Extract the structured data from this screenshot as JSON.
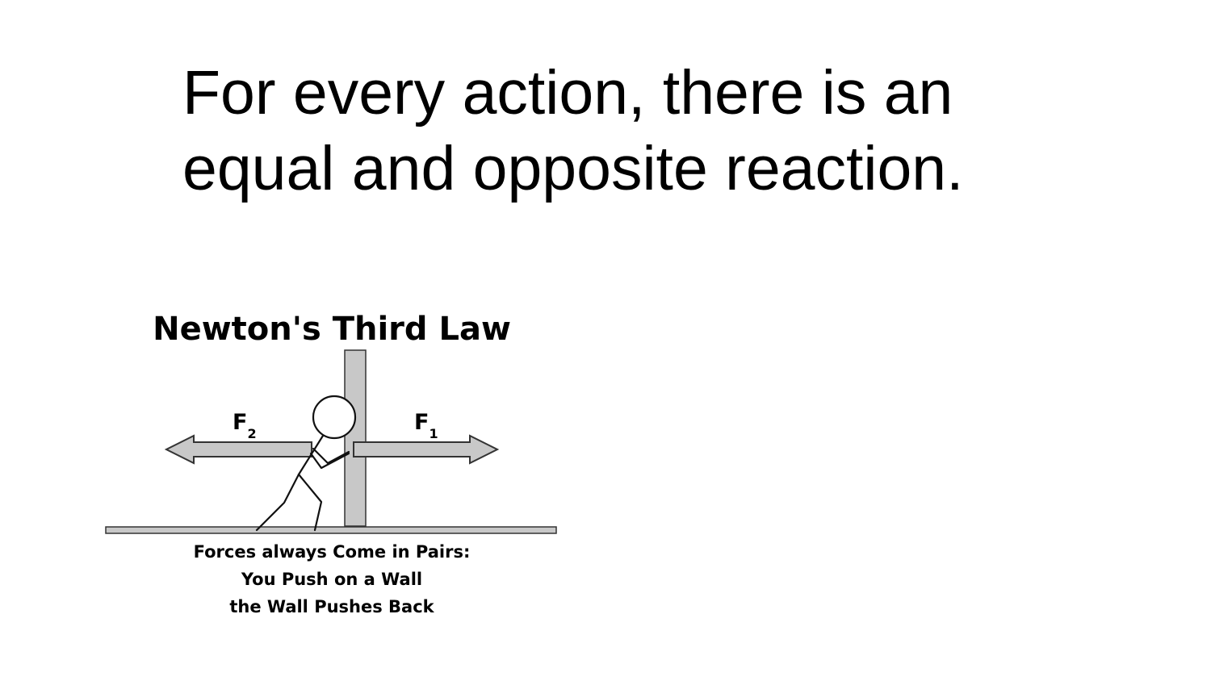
{
  "slide": {
    "title_line1": "For every action, there is an",
    "title_line2": "equal and opposite reaction."
  },
  "diagram": {
    "title": "Newton's Third Law",
    "force_left": {
      "letter": "F",
      "subscript": "2"
    },
    "force_right": {
      "letter": "F",
      "subscript": "1"
    },
    "caption_lines": [
      "Forces always Come in Pairs:",
      "You Push on a Wall",
      "the Wall Pushes Back"
    ],
    "colors": {
      "fill_gray": "#c8c8c8",
      "stroke": "#333333"
    }
  }
}
